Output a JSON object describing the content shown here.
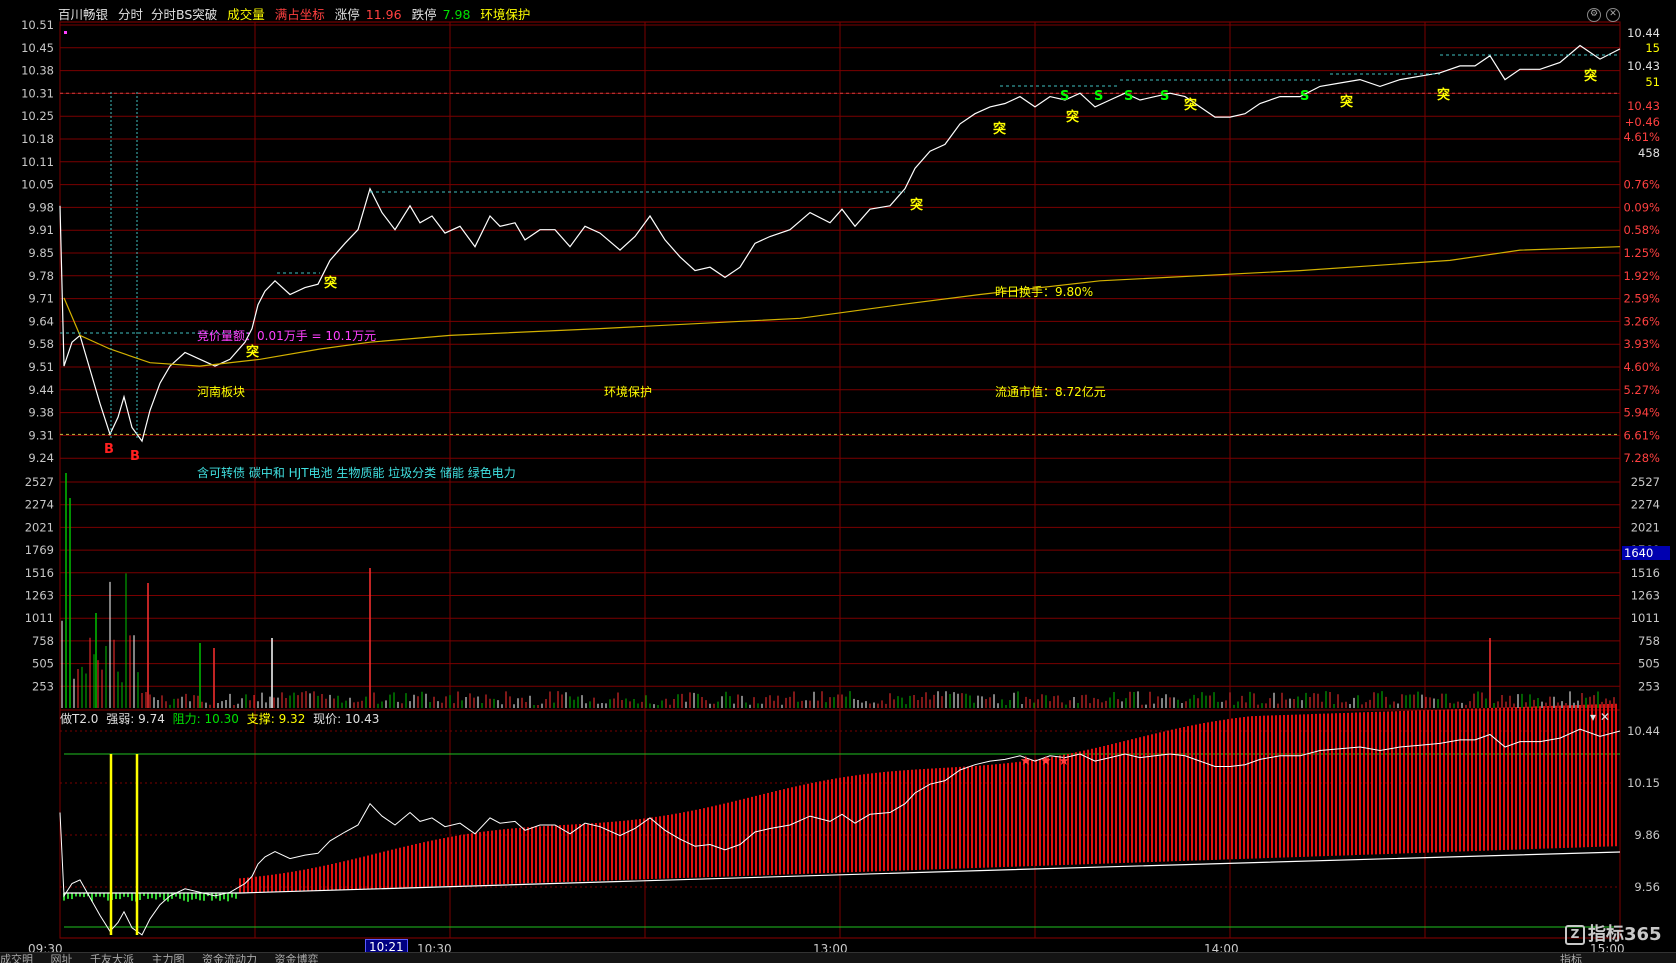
{
  "header": {
    "stock_name": "百川畅银",
    "tab_intraday": "分时",
    "tab_bs": "分时BS突破",
    "volume": "成交量",
    "full_coord": "满占坐标",
    "limit_up_label": "涨停",
    "limit_up_value": "11.96",
    "limit_down_label": "跌停",
    "limit_down_value": "7.98",
    "concept": "环境保护"
  },
  "price_axis_left": [
    "10.51",
    "10.45",
    "10.38",
    "10.31",
    "10.25",
    "10.18",
    "10.11",
    "10.05",
    "9.98",
    "9.91",
    "9.85",
    "9.78",
    "9.71",
    "9.64",
    "9.58",
    "9.51",
    "9.44",
    "9.38",
    "9.31",
    "9.24"
  ],
  "pct_axis_right": [
    "0.76%",
    "0.09%",
    "0.58%",
    "1.25%",
    "1.92%",
    "2.59%",
    "3.26%",
    "3.93%",
    "4.60%",
    "5.27%",
    "5.94%",
    "6.61%",
    "7.28%"
  ],
  "info_panel": {
    "price1": "10.44",
    "vol1": "15",
    "price2": "10.43",
    "vol2": "51",
    "price3": "10.43",
    "change": "+0.46",
    "change_pct": "4.61%",
    "total": "458"
  },
  "volume_axis": [
    "2527",
    "2274",
    "2021",
    "1769",
    "1516",
    "1263",
    "1011",
    "758",
    "505",
    "253"
  ],
  "volume_marker": "1640",
  "annotations": {
    "auction": "竞价量额：0.01万手 = 10.1万元",
    "region": "河南板块",
    "theme": "环境保护",
    "turnover": "昨日换手：9.80%",
    "float_cap": "流通市值：8.72亿元",
    "concepts": "含可转债 碳中和 HJT电池 生物质能 垃圾分类 储能 绿色电力"
  },
  "indicator": {
    "name": "做T2.0",
    "strength_label": "强弱:",
    "strength_value": "9.74",
    "resistance_label": "阻力:",
    "resistance_value": "10.30",
    "support_label": "支撑:",
    "support_value": "9.32",
    "price_label": "现价:",
    "price_value": "10.43",
    "axis": [
      "10.44",
      "10.15",
      "9.86",
      "9.56"
    ]
  },
  "time_axis": {
    "t0930": "09:30",
    "cursor": "10:21",
    "t1030": "10:30",
    "t1300": "13:00",
    "t1400": "14:00",
    "t1500": "15:00"
  },
  "signal_labels": {
    "buy": "B",
    "breakout": "突",
    "sell": "S"
  },
  "logo_text": "指标365",
  "logo_mark": "Z",
  "bottom_tabs": [
    "成交明",
    "网址",
    "千友大派",
    "主力图",
    "资金流动力",
    "资金博弈",
    "指标"
  ],
  "colors": {
    "bg": "#000000",
    "grid_red": "#8b0000",
    "price_line": "#ffffff",
    "avg_line": "#d2b000",
    "vol_up": "#ff3030",
    "vol_down": "#00c000",
    "yellow": "#ffff00",
    "cyan": "#40c0c0",
    "magenta": "#ff40ff",
    "green_signal": "#00ff00"
  }
}
